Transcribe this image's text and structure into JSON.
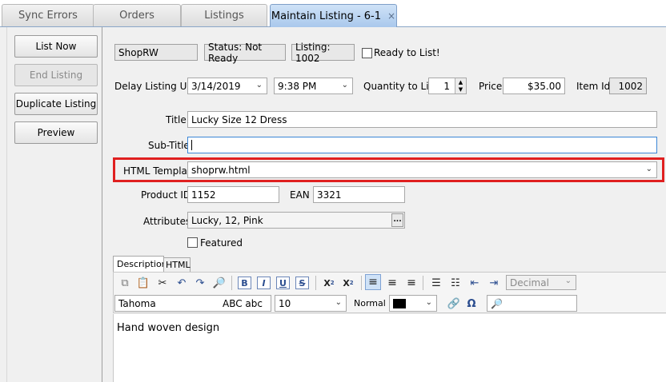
{
  "tabs": [
    {
      "label": "Sync Errors"
    },
    {
      "label": "Orders"
    },
    {
      "label": "Listings"
    },
    {
      "label": "Maintain Listing - 6-1",
      "active": true
    }
  ],
  "tab_close_icon": "×",
  "side_buttons": {
    "list_now": "List Now",
    "end_listing": "End Listing",
    "duplicate_listing": "Duplicate Listing",
    "preview": "Preview"
  },
  "header": {
    "store": "ShopRW",
    "status": "Status: Not Ready",
    "listing": "Listing: 1002",
    "ready_to_list_label": "Ready to List!",
    "ready_to_list_checked": false
  },
  "delay": {
    "label": "Delay Listing Until",
    "date": "3/14/2019",
    "time": "9:38 PM"
  },
  "quantity": {
    "label": "Quantity to List",
    "value": "1"
  },
  "price": {
    "label": "Price",
    "value": "$35.00"
  },
  "item_id": {
    "label": "Item Id",
    "value": "1002"
  },
  "title": {
    "label": "Title",
    "value": "Lucky Size 12 Dress"
  },
  "subtitle": {
    "label": "Sub-Title",
    "value": ""
  },
  "html_template": {
    "label": "HTML Template",
    "value": "shoprw.html"
  },
  "product_id": {
    "label": "Product ID",
    "value": "1152"
  },
  "ean": {
    "label": "EAN",
    "value": "3321"
  },
  "attributes": {
    "label": "Attributes",
    "value": "Lucky, 12, Pink",
    "button": "..."
  },
  "featured": {
    "label": "Featured",
    "checked": false
  },
  "editor": {
    "tabs": [
      "Description",
      "HTML"
    ],
    "font": "Tahoma",
    "font_preview": "ABC abc",
    "font_size": "10",
    "style": "Normal",
    "number_format": "Decimal",
    "content": "Hand woven design"
  },
  "colors": {
    "highlight": "#e02020",
    "active_tab": "#a9c8ec"
  }
}
